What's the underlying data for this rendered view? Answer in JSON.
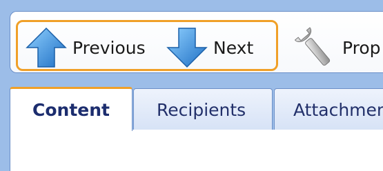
{
  "toolbar": {
    "previous_label": "Previous",
    "next_label": "Next",
    "properties_label": "Prop"
  },
  "tabs": [
    {
      "label": "Content",
      "active": true
    },
    {
      "label": "Recipients",
      "active": false
    },
    {
      "label": "Attachmen",
      "active": false
    }
  ],
  "colors": {
    "window_background": "#9cbde8",
    "highlight_border": "#f0a028",
    "arrow_blue": "#2e8ad8",
    "tab_text": "#22306a"
  },
  "icons": {
    "previous": "up-arrow-icon",
    "next": "down-arrow-icon",
    "properties": "wrench-icon"
  }
}
